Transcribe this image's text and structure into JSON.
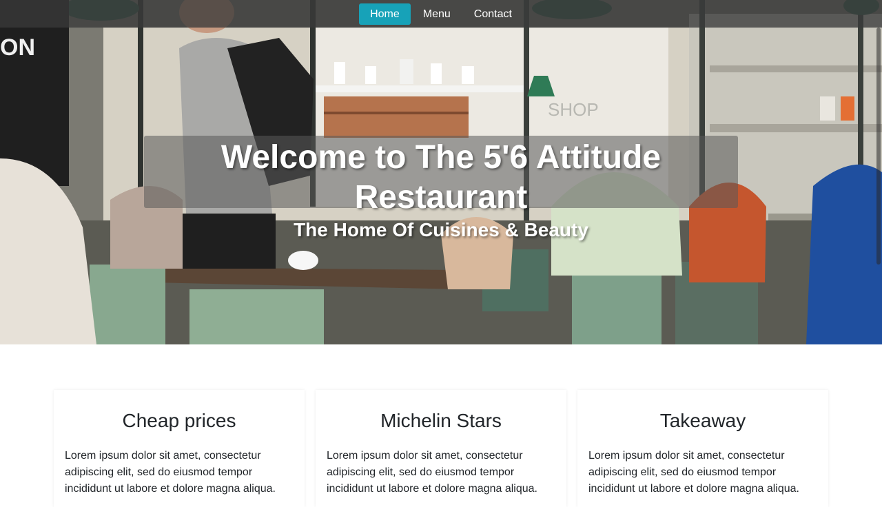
{
  "nav": {
    "items": [
      {
        "label": "Home",
        "active": true
      },
      {
        "label": "Menu",
        "active": false
      },
      {
        "label": "Contact",
        "active": false
      }
    ]
  },
  "hero": {
    "title": "Welcome to The 5'6 Attitude Restaurant",
    "subtitle": "The Home Of Cuisines & Beauty",
    "photo_text": "SHOP",
    "shirt_text": "ON"
  },
  "features": [
    {
      "title": "Cheap prices",
      "text": "Lorem ipsum dolor sit amet, consectetur adipiscing elit, sed do eiusmod tempor incididunt ut labore et dolore magna aliqua."
    },
    {
      "title": "Michelin Stars",
      "text": "Lorem ipsum dolor sit amet, consectetur adipiscing elit, sed do eiusmod tempor incididunt ut labore et dolore magna aliqua."
    },
    {
      "title": "Takeaway",
      "text": "Lorem ipsum dolor sit amet, consectetur adipiscing elit, sed do eiusmod tempor incididunt ut labore et dolore magna aliqua."
    }
  ],
  "colors": {
    "accent": "#17a2b8",
    "navbar": "#3a3a3a",
    "text": "#212529"
  }
}
